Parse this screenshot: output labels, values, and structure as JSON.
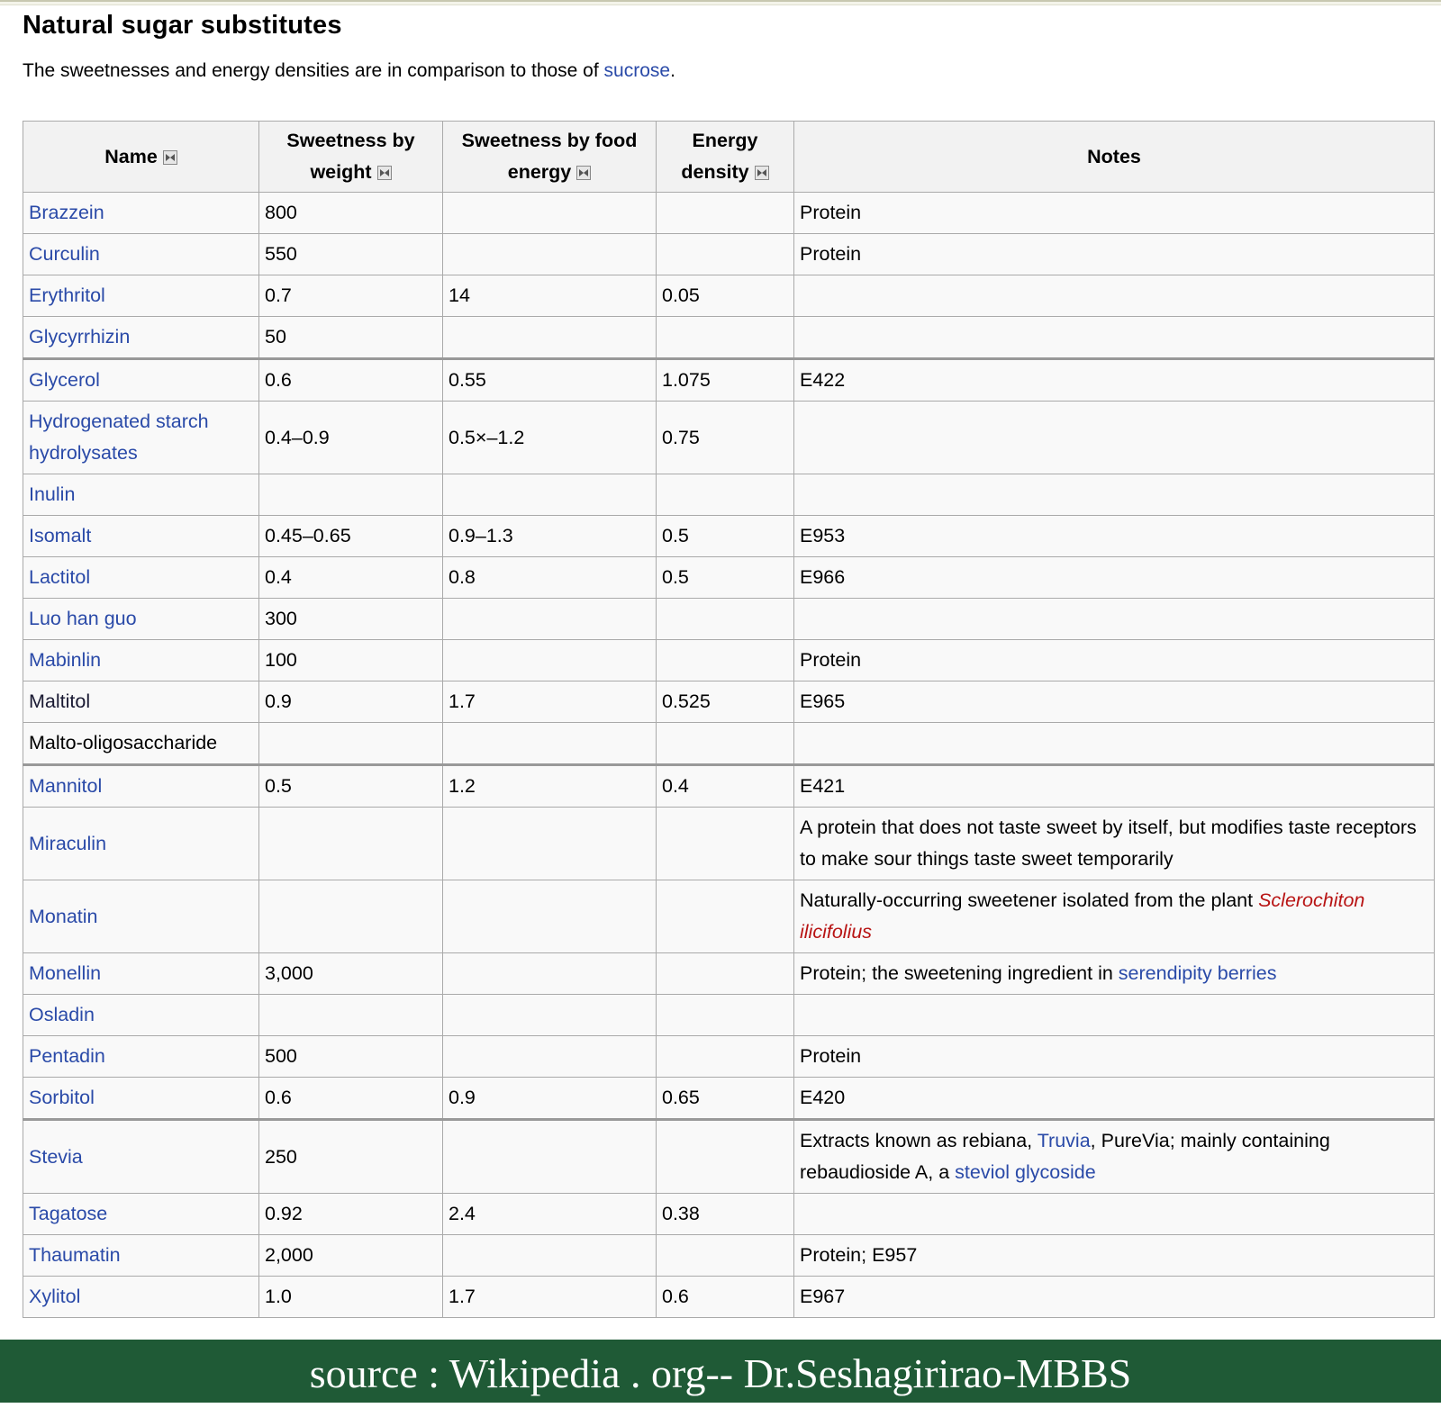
{
  "heading": "Natural sugar substitutes",
  "intro": {
    "text": "The sweetnesses and energy densities are in comparison to those of ",
    "link": "sucrose",
    "end": "."
  },
  "table": {
    "headers": {
      "name": "Name",
      "sweetness_weight": "Sweetness by weight",
      "sweetness_energy": "Sweetness by food energy",
      "energy_density": "Energy density",
      "notes": "Notes"
    },
    "rows": [
      {
        "name": "Brazzein",
        "sw": "800",
        "se": "",
        "ed": "",
        "notes": "Protein"
      },
      {
        "name": "Curculin",
        "sw": "550",
        "se": "",
        "ed": "",
        "notes": "Protein"
      },
      {
        "name": "Erythritol",
        "sw": "0.7",
        "se": "14",
        "ed": "0.05",
        "notes": ""
      },
      {
        "name": "Glycyrrhizin",
        "sw": "50",
        "se": "",
        "ed": "",
        "notes": ""
      },
      {
        "name": "Glycerol",
        "sw": "0.6",
        "se": "0.55",
        "ed": "1.075",
        "notes": "E422"
      },
      {
        "name": "Hydrogenated starch hydrolysates",
        "sw": "0.4–0.9",
        "se": "0.5×–1.2",
        "ed": "0.75",
        "notes": ""
      },
      {
        "name": "Inulin",
        "sw": "",
        "se": "",
        "ed": "",
        "notes": ""
      },
      {
        "name": "Isomalt",
        "sw": "0.45–0.65",
        "se": "0.9–1.3",
        "ed": "0.5",
        "notes": "E953"
      },
      {
        "name": "Lactitol",
        "sw": "0.4",
        "se": "0.8",
        "ed": "0.5",
        "notes": "E966"
      },
      {
        "name": "Luo han guo",
        "sw": "300",
        "se": "",
        "ed": "",
        "notes": ""
      },
      {
        "name": "Mabinlin",
        "sw": "100",
        "se": "",
        "ed": "",
        "notes": "Protein"
      },
      {
        "name": "Maltitol",
        "sw": "0.9",
        "se": "1.7",
        "ed": "0.525",
        "notes": "E965"
      },
      {
        "name": "Malto-oligosaccharide",
        "sw": "",
        "se": "",
        "ed": "",
        "notes": ""
      },
      {
        "name": "Mannitol",
        "sw": "0.5",
        "se": "1.2",
        "ed": "0.4",
        "notes": "E421"
      },
      {
        "name": "Miraculin",
        "sw": "",
        "se": "",
        "ed": "",
        "notes": "A protein that does not taste sweet by itself, but modifies taste receptors to make sour things taste sweet temporarily"
      },
      {
        "name": "Monatin",
        "sw": "",
        "se": "",
        "ed": "",
        "notes_pre": "Naturally-occurring sweetener isolated from the plant ",
        "notes_redlink": "Sclerochiton ilicifolius"
      },
      {
        "name": "Monellin",
        "sw": "3,000",
        "se": "",
        "ed": "",
        "notes_pre": "Protein; the sweetening ingredient in ",
        "notes_link": "serendipity berries"
      },
      {
        "name": "Osladin",
        "sw": "",
        "se": "",
        "ed": "",
        "notes": ""
      },
      {
        "name": "Pentadin",
        "sw": "500",
        "se": "",
        "ed": "",
        "notes": "Protein"
      },
      {
        "name": "Sorbitol",
        "sw": "0.6",
        "se": "0.9",
        "ed": "0.65",
        "notes": "E420"
      },
      {
        "name": "Stevia",
        "sw": "250",
        "se": "",
        "ed": "",
        "notes_a": "Extracts known as rebiana, ",
        "notes_link1": "Truvia",
        "notes_b": ", PureVia; mainly containing rebaudioside A, a ",
        "notes_link2": "steviol glycoside"
      },
      {
        "name": "Tagatose",
        "sw": "0.92",
        "se": "2.4",
        "ed": "0.38",
        "notes": ""
      },
      {
        "name": "Thaumatin",
        "sw": "2,000",
        "se": "",
        "ed": "",
        "notes": "Protein; E957"
      },
      {
        "name": "Xylitol",
        "sw": "1.0",
        "se": "1.7",
        "ed": "0.6",
        "notes": "E967"
      }
    ]
  },
  "banner": "source : Wikipedia . org-- Dr.Seshagirirao-MBBS",
  "colors": {
    "link": "#2a4aa8",
    "redlink": "#b81414",
    "banner_bg": "#1f5a36"
  }
}
